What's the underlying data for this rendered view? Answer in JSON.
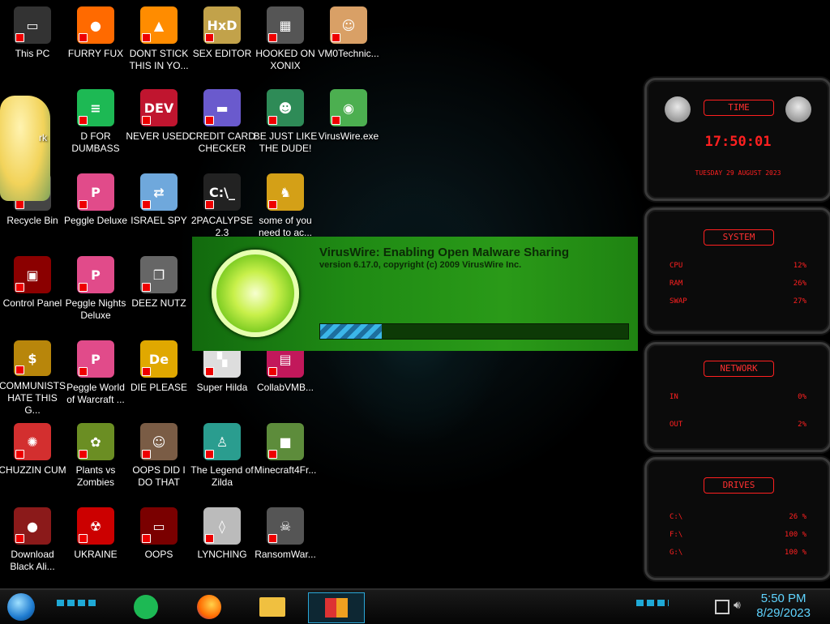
{
  "desktop": {
    "icons": [
      {
        "label": "This PC",
        "name": "this-pc-icon",
        "col": 0,
        "row": 0,
        "color": "#333",
        "glyph": "▭"
      },
      {
        "label": "FURRY FUX",
        "name": "firefox-icon",
        "col": 1,
        "row": 0,
        "color": "#ff6a00",
        "glyph": "●"
      },
      {
        "label": "DONT STICK THIS IN YO...",
        "name": "vlc-icon",
        "col": 2,
        "row": 0,
        "color": "#ff8c00",
        "glyph": "▲"
      },
      {
        "label": "SEX EDITOR",
        "name": "hxd-icon",
        "col": 3,
        "row": 0,
        "color": "#c2a24a",
        "glyph": "HxD"
      },
      {
        "label": "HOOKED ON XONIX",
        "name": "xonix-icon",
        "col": 4,
        "row": 0,
        "color": "#555",
        "glyph": "▦"
      },
      {
        "label": "VM0Technic...",
        "name": "doctor-icon",
        "col": 5,
        "row": 0,
        "color": "#d9a066",
        "glyph": "☺"
      },
      {
        "label": "D FOR DUMBASS",
        "name": "spotify-like-icon",
        "col": 1,
        "row": 1,
        "color": "#1db954",
        "glyph": "≡"
      },
      {
        "label": "NEVER USED!",
        "name": "devcpp-icon",
        "col": 2,
        "row": 1,
        "color": "#c0152f",
        "glyph": "DEV"
      },
      {
        "label": "CREDIT CARD CHECKER",
        "name": "credit-card-icon",
        "col": 3,
        "row": 1,
        "color": "#6a5acd",
        "glyph": "▬"
      },
      {
        "label": "BE JUST LIKE THE DUDE!",
        "name": "elf-icon",
        "col": 4,
        "row": 1,
        "color": "#2e8b57",
        "glyph": "☻"
      },
      {
        "label": "VirusWire.exe",
        "name": "limewire-icon",
        "col": 5,
        "row": 1,
        "color": "#4caf50",
        "glyph": "◉"
      },
      {
        "label": "Recycle Bin",
        "name": "recycle-bin-icon",
        "col": 0,
        "row": 2,
        "color": "#444",
        "glyph": "♻"
      },
      {
        "label": "Peggle Deluxe",
        "name": "peggle-icon",
        "col": 1,
        "row": 2,
        "color": "#e14b8a",
        "glyph": "P"
      },
      {
        "label": "ISRAEL SPY",
        "name": "network-spy-icon",
        "col": 2,
        "row": 2,
        "color": "#6fa8dc",
        "glyph": "⇄"
      },
      {
        "label": "2PACALYPSE 2.3",
        "name": "terminal-icon",
        "col": 3,
        "row": 2,
        "color": "#222",
        "glyph": "C:\\_"
      },
      {
        "label": "some of you need to ac...",
        "name": "dog-icon",
        "col": 4,
        "row": 2,
        "color": "#d4a017",
        "glyph": "♞"
      },
      {
        "label": "Control Panel",
        "name": "control-panel-icon",
        "col": 0,
        "row": 3,
        "color": "#8b0000",
        "glyph": "▣"
      },
      {
        "label": "Peggle Nights Deluxe",
        "name": "peggle-nights-icon",
        "col": 1,
        "row": 3,
        "color": "#e14b8a",
        "glyph": "P"
      },
      {
        "label": "DEEZ NUTZ",
        "name": "stacked-windows-icon",
        "col": 2,
        "row": 3,
        "color": "#666",
        "glyph": "❐"
      },
      {
        "label": "COMMUNISTS HATE THIS G...",
        "name": "money-bag-icon",
        "col": 0,
        "row": 4,
        "color": "#b8860b",
        "glyph": "$"
      },
      {
        "label": "Peggle World of Warcraft ...",
        "name": "peggle-wow-icon",
        "col": 1,
        "row": 4,
        "color": "#e14b8a",
        "glyph": "P"
      },
      {
        "label": "DIE PLEASE",
        "name": "de-icon",
        "col": 2,
        "row": 4,
        "color": "#e0a800",
        "glyph": "De"
      },
      {
        "label": "Super Hilda",
        "name": "pixel-sprite-icon",
        "col": 3,
        "row": 4,
        "color": "#ddd",
        "glyph": "▚"
      },
      {
        "label": "CollabVMB...",
        "name": "collabvm-icon",
        "col": 4,
        "row": 4,
        "color": "#c2185b",
        "glyph": "▤"
      },
      {
        "label": "CHUZZIN CUM",
        "name": "chuzzle-icon",
        "col": 0,
        "row": 5,
        "color": "#d32f2f",
        "glyph": "✺"
      },
      {
        "label": "Plants vs Zombies",
        "name": "pvz-icon",
        "col": 1,
        "row": 5,
        "color": "#6b8e23",
        "glyph": "✿"
      },
      {
        "label": "OOPS DID I DO THAT",
        "name": "portrait-icon",
        "col": 2,
        "row": 5,
        "color": "#7a5c45",
        "glyph": "☺"
      },
      {
        "label": "The Legend of Zilda",
        "name": "zelda-sprite-icon",
        "col": 3,
        "row": 5,
        "color": "#2a9d8f",
        "glyph": "♙"
      },
      {
        "label": "Minecraft4Fr...",
        "name": "minecraft-icon",
        "col": 4,
        "row": 5,
        "color": "#5d8c3b",
        "glyph": "■"
      },
      {
        "label": "Download Black Ali...",
        "name": "alien-download-icon",
        "col": 0,
        "row": 6,
        "color": "#8b1a1a",
        "glyph": "●"
      },
      {
        "label": "UKRAINE",
        "name": "radiation-icon",
        "col": 1,
        "row": 6,
        "color": "#cc0000",
        "glyph": "☢"
      },
      {
        "label": "OOPS",
        "name": "red-laptop-icon",
        "col": 2,
        "row": 6,
        "color": "#7a0000",
        "glyph": "▭"
      },
      {
        "label": "LYNCHING",
        "name": "rope-icon",
        "col": 3,
        "row": 6,
        "color": "#bbb",
        "glyph": "◊"
      },
      {
        "label": "RansomWar...",
        "name": "skull-icon",
        "col": 4,
        "row": 6,
        "color": "#555",
        "glyph": "☠"
      }
    ],
    "partial_label": "rk"
  },
  "splash": {
    "title": "VirusWire: Enabling Open Malware Sharing",
    "subtitle": "version 6.17.0, copyright (c) 2009 VirusWire Inc.",
    "progress": 0.2
  },
  "gadgets": {
    "time": {
      "header": "TIME",
      "clock": "17:50:01",
      "date": "TUESDAY 29 AUGUST 2023"
    },
    "system": {
      "header": "SYSTEM",
      "rows": [
        {
          "label": "CPU",
          "value": "12%"
        },
        {
          "label": "RAM",
          "value": "26%"
        },
        {
          "label": "SWAP",
          "value": "27%"
        }
      ]
    },
    "network": {
      "header": "NETWORK",
      "rows": [
        {
          "label": "IN",
          "value": "0%"
        },
        {
          "label": "OUT",
          "value": "2%"
        }
      ]
    },
    "drives": {
      "header": "DRIVES",
      "rows": [
        {
          "label": "C:\\",
          "value": "26 %"
        },
        {
          "label": "F:\\",
          "value": "100 %"
        },
        {
          "label": "G:\\",
          "value": "100 %"
        }
      ]
    }
  },
  "taskbar": {
    "time": "5:50 PM",
    "date": "8/29/2023"
  }
}
